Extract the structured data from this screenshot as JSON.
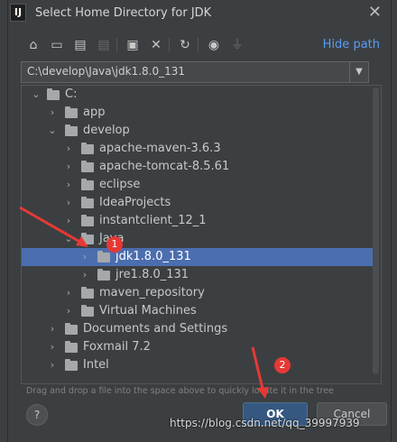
{
  "dialog": {
    "title": "Select Home Directory for JDK",
    "app_icon": "IJ"
  },
  "toolbar": {
    "icons": [
      "home-icon",
      "desktop-icon",
      "project-icon",
      "module-icon",
      "new-folder-icon",
      "delete-icon",
      "refresh-icon",
      "show-hidden-icon",
      "link-icon"
    ],
    "hide_path_label": "Hide path"
  },
  "path": {
    "value": "C:\\develop\\Java\\jdk1.8.0_131"
  },
  "tree": {
    "items": [
      {
        "label": "C:",
        "expanded": true
      },
      {
        "label": "app",
        "expanded": false
      },
      {
        "label": "develop",
        "expanded": true
      },
      {
        "label": "apache-maven-3.6.3",
        "expanded": false
      },
      {
        "label": "apache-tomcat-8.5.61",
        "expanded": false
      },
      {
        "label": "eclipse",
        "expanded": false
      },
      {
        "label": "IdeaProjects",
        "expanded": false
      },
      {
        "label": "instantclient_12_1",
        "expanded": false
      },
      {
        "label": "Java",
        "expanded": true
      },
      {
        "label": "jdk1.8.0_131",
        "expanded": false,
        "selected": true
      },
      {
        "label": "jre1.8.0_131",
        "expanded": false
      },
      {
        "label": "maven_repository",
        "expanded": false
      },
      {
        "label": "Virtual Machines",
        "expanded": false
      },
      {
        "label": "Documents and Settings",
        "expanded": false
      },
      {
        "label": "Foxmail 7.2",
        "expanded": false
      },
      {
        "label": "Intel",
        "expanded": false
      }
    ]
  },
  "hint": "Drag and drop a file into the space above to quickly locate it in the tree",
  "buttons": {
    "help": "?",
    "ok": "OK",
    "cancel": "Cancel"
  },
  "annotations": {
    "badge1": "1",
    "badge2": "2",
    "color": "#e53935"
  },
  "watermark": "https://blog.csdn.net/qq_39997939"
}
